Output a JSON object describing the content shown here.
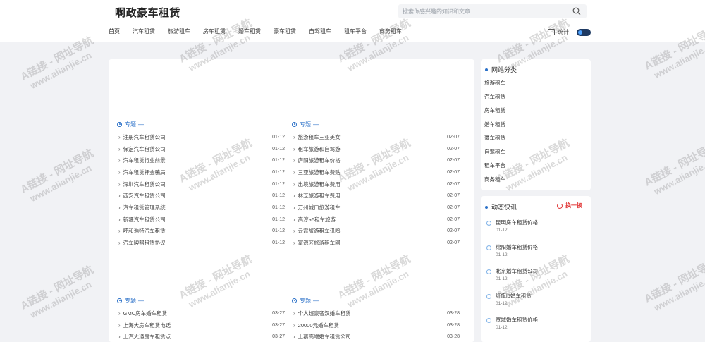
{
  "header": {
    "site_title": "啊政豪车租赁",
    "search_placeholder": "搜索你感兴趣的知识和文章",
    "nav": [
      "首页",
      "汽车租赁",
      "旅游租车",
      "房车租赁",
      "婚车租赁",
      "豪车租赁",
      "自驾租车",
      "租车平台",
      "商务租车"
    ],
    "stats_label": "统计"
  },
  "main": {
    "sections": [
      {
        "head": "专题",
        "dash": "—",
        "items": [
          {
            "t": "注册汽车租赁公司",
            "d": "01-12"
          },
          {
            "t": "保定汽车租赁公司",
            "d": "01-12"
          },
          {
            "t": "汽车租赁行业前景",
            "d": "01-12"
          },
          {
            "t": "汽车租赁押金骗局",
            "d": "01-12"
          },
          {
            "t": "深圳汽车租赁公司",
            "d": "01-12"
          },
          {
            "t": "西安汽车租赁公司",
            "d": "01-12"
          },
          {
            "t": "汽车租赁管理系统",
            "d": "01-12"
          },
          {
            "t": "新疆汽车租赁公司",
            "d": "01-12"
          },
          {
            "t": "呼和浩特汽车租赁",
            "d": "01-12"
          },
          {
            "t": "汽车牌照租赁协议",
            "d": "01-12"
          }
        ]
      },
      {
        "head": "专题",
        "dash": "—",
        "items": [
          {
            "t": "旅游租车三亚美女",
            "d": "02-07"
          },
          {
            "t": "租车旅游和自驾游",
            "d": "02-07"
          },
          {
            "t": "庐阳旅游租车价格",
            "d": "02-07"
          },
          {
            "t": "三亚旅游租车费贴",
            "d": "02-07"
          },
          {
            "t": "出境旅游租车费用",
            "d": "02-07"
          },
          {
            "t": "林芝旅游租车费用",
            "d": "02-07"
          },
          {
            "t": "万州城口旅游租车",
            "d": "02-07"
          },
          {
            "t": "高淳a6租车旅游",
            "d": "02-07"
          },
          {
            "t": "云霞旅游租车讯鸣",
            "d": "02-07"
          },
          {
            "t": "富源区旅游租车网",
            "d": "02-07"
          }
        ]
      },
      {
        "head": "专题",
        "dash": "—",
        "items": [
          {
            "t": "GMC房车婚车租赁",
            "d": "03-27"
          },
          {
            "t": "上海大房车租赁电话",
            "d": "03-27"
          },
          {
            "t": "上汽大通房车租赁点",
            "d": "03-27"
          }
        ]
      },
      {
        "head": "专题",
        "dash": "—",
        "items": [
          {
            "t": "个人超豪奢汉婚车租赁",
            "d": "03-28"
          },
          {
            "t": "20000元婚车租赁",
            "d": "03-28"
          },
          {
            "t": "上蔡高端婚车租赁公司",
            "d": "03-28"
          }
        ]
      }
    ]
  },
  "sidebar": {
    "categories_title": "网站分类",
    "categories": [
      "旅游租车",
      "汽车租赁",
      "房车租赁",
      "婚车租赁",
      "豪车租赁",
      "自驾租车",
      "租车平台",
      "商务租车"
    ],
    "news_title": "动态快讯",
    "refresh_label": "换一换",
    "news": [
      {
        "t": "昆明房车租赁价格",
        "d": "01-12"
      },
      {
        "t": "绵阳婚车租赁价格",
        "d": "01-12"
      },
      {
        "t": "北京婚车租赁公司",
        "d": "01-12"
      },
      {
        "t": "红旗l5婚车租赁",
        "d": "01-12"
      },
      {
        "t": "宽城婚车租赁价格",
        "d": "01-12"
      }
    ]
  },
  "watermark": {
    "line1": "A链接 - 网址导航",
    "line2": "www.alianjie.cn"
  },
  "colors": {
    "accent": "#2a70c8",
    "refresh": "#e23a3a",
    "toggle": "#1e3a63"
  }
}
